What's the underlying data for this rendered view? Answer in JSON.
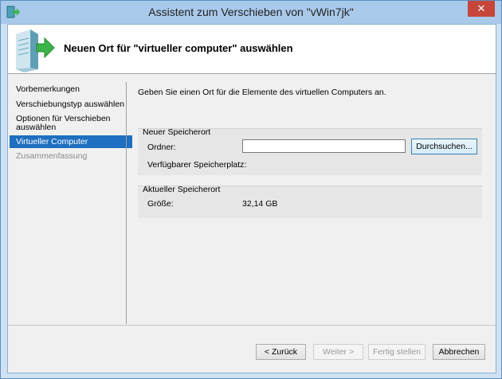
{
  "window": {
    "title": "Assistent zum Verschieben von \"vWin7jk\"",
    "close_glyph": "✕"
  },
  "header": {
    "title": "Neuen Ort für \"virtueller computer\" auswählen",
    "icon": "server-move-icon"
  },
  "nav": {
    "items": [
      {
        "label": "Vorbemerkungen",
        "state": "normal"
      },
      {
        "label": "Verschiebungstyp auswählen",
        "state": "normal"
      },
      {
        "label": "Optionen für Verschieben auswählen",
        "state": "normal"
      },
      {
        "label": "Virtueller Computer",
        "state": "selected"
      },
      {
        "label": "Zusammenfassung",
        "state": "disabled"
      }
    ]
  },
  "content": {
    "intro": "Geben Sie einen Ort für die Elemente des virtuellen Computers an.",
    "new_location": {
      "label": "Neuer Speicherort",
      "folder_label": "Ordner:",
      "folder_value": "",
      "browse_button": "Durchsuchen...",
      "free_space_label": "Verfügbarer Speicherplatz:",
      "free_space_value": ""
    },
    "current_location": {
      "label": "Aktueller Speicherort",
      "size_label": "Größe:",
      "size_value": "32,14 GB"
    }
  },
  "footer": {
    "back": "< Zurück",
    "next": "Weiter >",
    "finish": "Fertig stellen",
    "cancel": "Abbrechen"
  },
  "colors": {
    "accent": "#1e6fc0",
    "titlebar": "#a9c9ea",
    "close": "#c7463b"
  }
}
